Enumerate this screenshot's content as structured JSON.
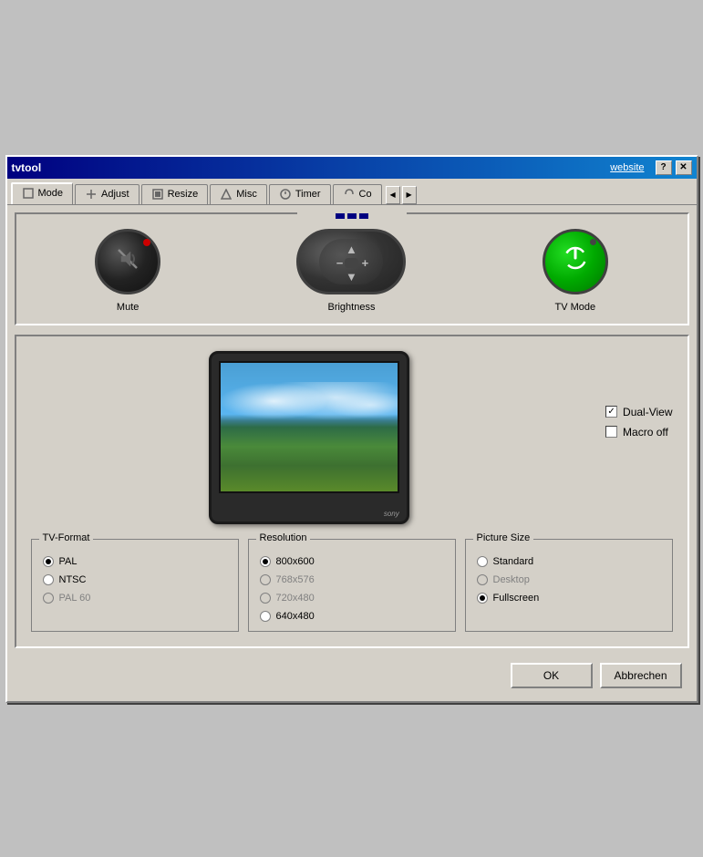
{
  "window": {
    "title": "tvtool",
    "website_link": "website",
    "help_btn": "?",
    "close_btn": "✕"
  },
  "tabs": [
    {
      "id": "mode",
      "label": "Mode",
      "icon": "mode-icon",
      "active": true
    },
    {
      "id": "adjust",
      "label": "Adjust",
      "icon": "adjust-icon"
    },
    {
      "id": "resize",
      "label": "Resize",
      "icon": "resize-icon"
    },
    {
      "id": "misc",
      "label": "Misc",
      "icon": "misc-icon"
    },
    {
      "id": "timer",
      "label": "Timer",
      "icon": "timer-icon"
    },
    {
      "id": "co",
      "label": "Co",
      "icon": "co-icon"
    }
  ],
  "controls": {
    "mute_label": "Mute",
    "brightness_label": "Brightness",
    "tvmode_label": "TV Mode"
  },
  "checkboxes": {
    "dual_view": {
      "label": "Dual-View",
      "checked": true
    },
    "macro_off": {
      "label": "Macro off",
      "checked": false
    }
  },
  "tv_format": {
    "title": "TV-Format",
    "options": [
      {
        "label": "PAL",
        "selected": true,
        "disabled": false
      },
      {
        "label": "NTSC",
        "selected": false,
        "disabled": false
      },
      {
        "label": "PAL 60",
        "selected": false,
        "disabled": true
      }
    ]
  },
  "resolution": {
    "title": "Resolution",
    "options": [
      {
        "label": "800x600",
        "selected": true,
        "disabled": false
      },
      {
        "label": "768x576",
        "selected": false,
        "disabled": true
      },
      {
        "label": "720x480",
        "selected": false,
        "disabled": true
      },
      {
        "label": "640x480",
        "selected": false,
        "disabled": false
      }
    ]
  },
  "picture_size": {
    "title": "Picture Size",
    "options": [
      {
        "label": "Standard",
        "selected": false,
        "disabled": false
      },
      {
        "label": "Desktop",
        "selected": false,
        "disabled": true
      },
      {
        "label": "Fullscreen",
        "selected": true,
        "disabled": false
      }
    ]
  },
  "buttons": {
    "ok": "OK",
    "cancel": "Abbrechen"
  }
}
